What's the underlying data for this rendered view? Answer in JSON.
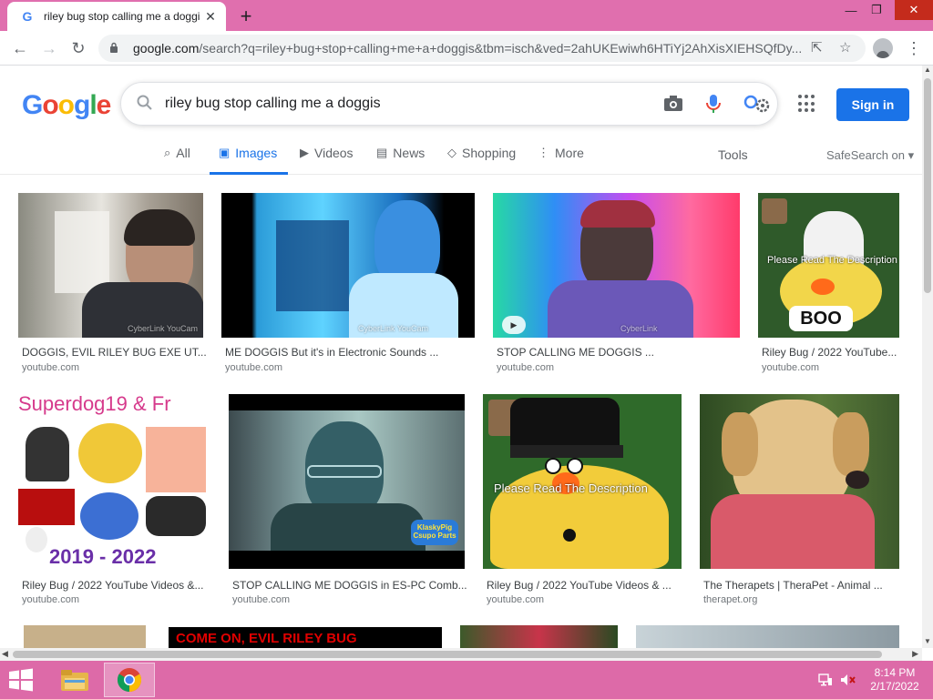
{
  "browser": {
    "tab_title": "riley bug stop calling me a doggis - Google Search",
    "tab_favicon": "G",
    "url_host": "google.com",
    "url_rest": "/search?q=riley+bug+stop+calling+me+a+doggis&tbm=isch&ved=2ahUKEwiwh6HTiYj2AhXisXIEHSQfDy..."
  },
  "google": {
    "logo_letters": [
      "G",
      "o",
      "o",
      "g",
      "l",
      "e"
    ],
    "search_query": "riley bug stop calling me a doggis",
    "signin_label": "Sign in",
    "tabs": [
      {
        "label": "All",
        "icon": "search-icon"
      },
      {
        "label": "Images",
        "icon": "image-icon",
        "active": true
      },
      {
        "label": "Videos",
        "icon": "play-icon"
      },
      {
        "label": "News",
        "icon": "news-icon"
      },
      {
        "label": "Shopping",
        "icon": "tag-icon"
      },
      {
        "label": "More",
        "icon": "more-vert-icon"
      }
    ],
    "tools_label": "Tools",
    "safesearch_label": "SafeSearch on"
  },
  "results": [
    {
      "title": "DOGGIS, EVIL RILEY BUG EXE UT...",
      "source": "youtube.com",
      "watermark": "CyberLink YouCam"
    },
    {
      "title": "ME DOGGIS But it's in Electronic Sounds ...",
      "source": "youtube.com",
      "watermark": "CyberLink YouCam"
    },
    {
      "title": "STOP CALLING ME DOGGIS ...",
      "source": "youtube.com",
      "watermark": "CyberLink"
    },
    {
      "title": "Riley Bug / 2022 YouTube...",
      "source": "youtube.com",
      "overlay": "Please Read The Description",
      "badge": "BOO"
    },
    {
      "title": "Riley Bug / 2022 YouTube Videos &...",
      "source": "youtube.com",
      "overlay_top": "Superdog19 & Fr",
      "overlay_bottom": "2019 - 2022"
    },
    {
      "title": "STOP CALLING ME DOGGIS in ES-PC Comb...",
      "source": "youtube.com",
      "watermark": "KlaskyPig Csupo Parts"
    },
    {
      "title": "Riley Bug / 2022 YouTube Videos & ...",
      "source": "youtube.com",
      "overlay": "Please Read The Description"
    },
    {
      "title": "The Therapets | TheraPet - Animal ...",
      "source": "therapet.org"
    }
  ],
  "partial_row": {
    "banner_text": "COME ON, EVIL RILEY BUG"
  },
  "taskbar": {
    "time": "8:14 PM",
    "date": "2/17/2022"
  },
  "colors": {
    "window_frame": "#e06fae",
    "taskbar": "#dd6aa8",
    "accent": "#1a73e8"
  }
}
